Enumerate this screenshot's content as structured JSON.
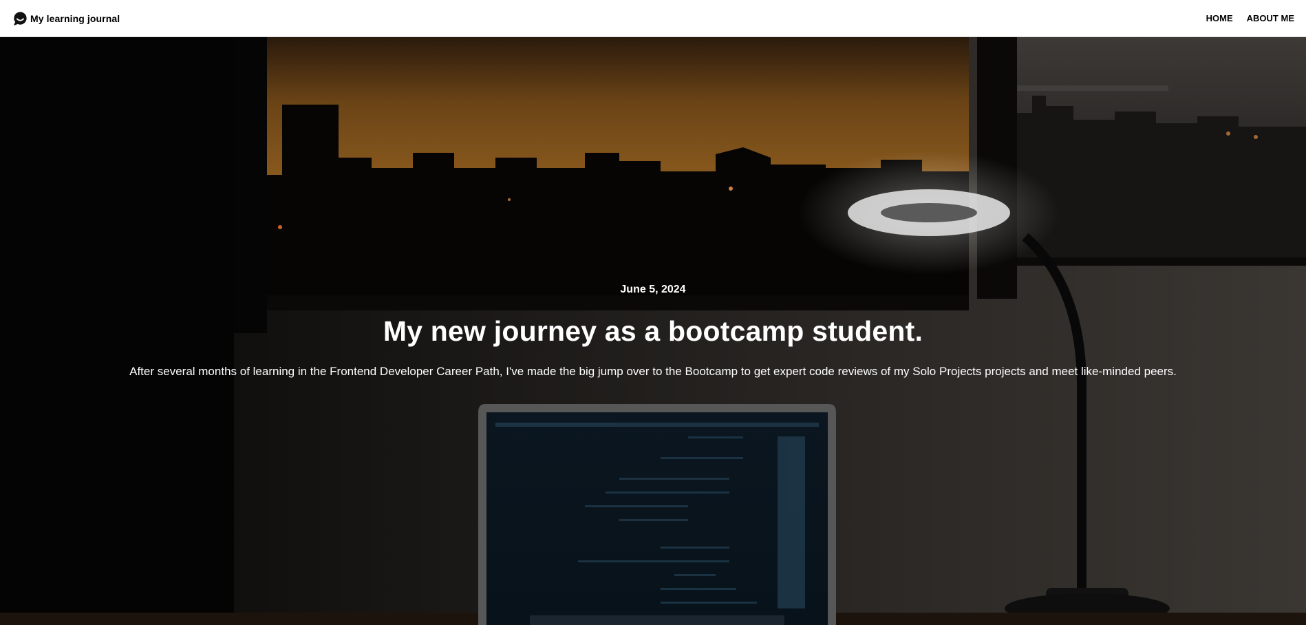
{
  "header": {
    "brand_title": "My learning journal",
    "brand_icon": "chat-bubble-icon",
    "nav": [
      {
        "label": "HOME"
      },
      {
        "label": "ABOUT ME"
      }
    ]
  },
  "hero": {
    "date": "June 5, 2024",
    "title": "My new journey as a bootcamp student.",
    "excerpt": "After several months of learning in the Frontend Developer Career Path, I've made the big jump over to the Bootcamp to get expert code reviews of my Solo Projects projects and meet like-minded peers.",
    "background_image": "desk-at-night-with-laptop-and-lamp"
  },
  "colors": {
    "header_bg": "#ffffff",
    "header_text": "#000000",
    "hero_text": "#ffffff"
  }
}
